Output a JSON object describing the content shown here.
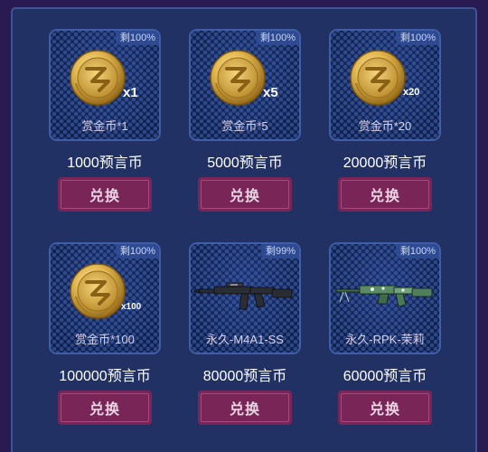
{
  "shop": {
    "items": [
      {
        "badge": "剩100%",
        "name": "赏金币*1",
        "price": "1000预言币",
        "button": "兑换",
        "icon": "coin-icon",
        "qty": "x1"
      },
      {
        "badge": "剩100%",
        "name": "赏金币*5",
        "price": "5000预言币",
        "button": "兑换",
        "icon": "coin-icon",
        "qty": "x5"
      },
      {
        "badge": "剩100%",
        "name": "赏金币*20",
        "price": "20000预言币",
        "button": "兑换",
        "icon": "coin-icon",
        "qty": "x20"
      },
      {
        "badge": "剩100%",
        "name": "赏金币*100",
        "price": "100000预言币",
        "button": "兑换",
        "icon": "coin-icon",
        "qty": "x100"
      },
      {
        "badge": "剩99%",
        "name": "永久-M4A1-SS",
        "price": "80000预言币",
        "button": "兑换",
        "icon": "rifle-icon"
      },
      {
        "badge": "剩100%",
        "name": "永久-RPK-茉莉",
        "price": "60000预言币",
        "button": "兑换",
        "icon": "machine-gun-icon"
      }
    ]
  },
  "colors": {
    "background": "#2a1a52",
    "panel": "#223163",
    "card_border": "#3f5ea7",
    "button": "#7a2558",
    "coin_gold": "#e3b84f"
  }
}
